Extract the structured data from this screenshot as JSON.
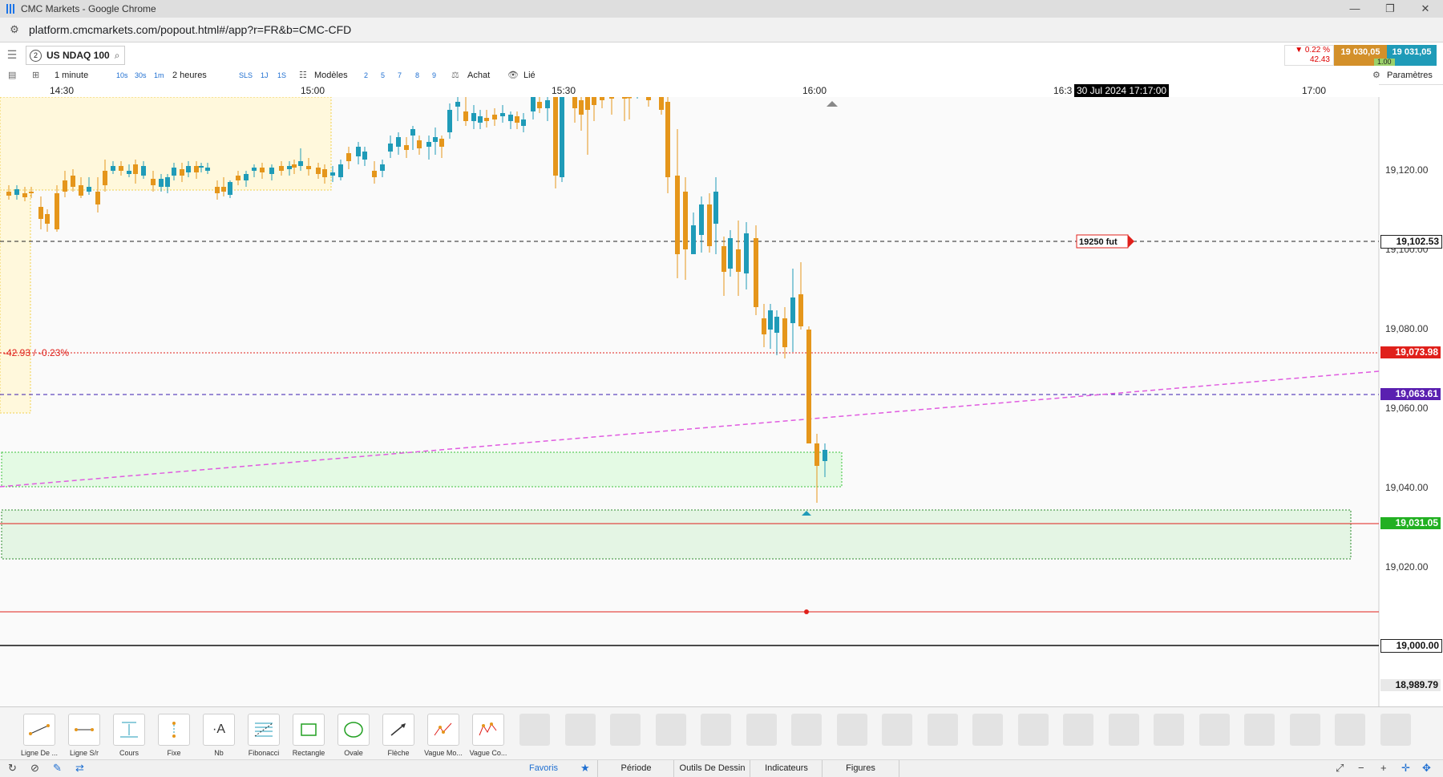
{
  "window": {
    "title": "CMC Markets - Google Chrome",
    "controls": [
      "—",
      "❐",
      "✕"
    ]
  },
  "browser": {
    "url": "platform.cmcmarkets.com/popout.html#/app?r=FR&b=CMC-CFD"
  },
  "instrument": {
    "index": "2",
    "name": "US NDAQ 100"
  },
  "quote": {
    "change_pct": "▼ 0.22 %",
    "change_abs": "42.43",
    "sell": "19 030,05",
    "buy": "19 031,05",
    "spread": "1.00"
  },
  "toolbar": {
    "interval": "1 minute",
    "intervals_short": [
      "10s",
      "30s",
      "1m"
    ],
    "range": "2 heures",
    "modes": [
      "SLS",
      "1J",
      "1S"
    ],
    "templates_label": "Modèles",
    "numbers": [
      "2",
      "5",
      "7",
      "8",
      "9"
    ],
    "buy_label": "Achat",
    "link_label": "Lié",
    "settings_label": "Paramètres"
  },
  "time_axis": {
    "ticks": [
      "14:30",
      "15:00",
      "15:30",
      "16:00",
      "16:3",
      "17:00"
    ],
    "cursor": "30 Jul 2024 17:17:00"
  },
  "price_axis": {
    "ticks": [
      "19,120.00",
      "19,100.00",
      "19,080.00",
      "19,060.00",
      "19,040.00",
      "19,020.00"
    ],
    "tags": {
      "level_black_dash": "19,102.53",
      "prev_close": "19,073.98",
      "purple_level": "19,063.61",
      "current": "19,031.05",
      "round": "19,000.00",
      "low": "18,989.79"
    }
  },
  "annotations": {
    "change_text": "-42.93 / -0.23%",
    "fut_label": "19250 fut"
  },
  "colors": {
    "up": "#1f9bb8",
    "down": "#e5961b",
    "prev_close": "#e0201b",
    "purple": "#5a20b0",
    "trend": "#e05ce0",
    "zone": "#4ccf4c"
  },
  "drawing_tools": [
    "Ligne De ...",
    "Ligne S/r",
    "Cours",
    "Fixe",
    "Nb",
    "Fibonacci",
    "Rectangle",
    "Ovale",
    "Flèche",
    "Vague Mo...",
    "Vague Co..."
  ],
  "bottom_tabs": [
    "Favoris",
    "Période",
    "Outils De Dessin",
    "Indicateurs",
    "Figures"
  ]
}
